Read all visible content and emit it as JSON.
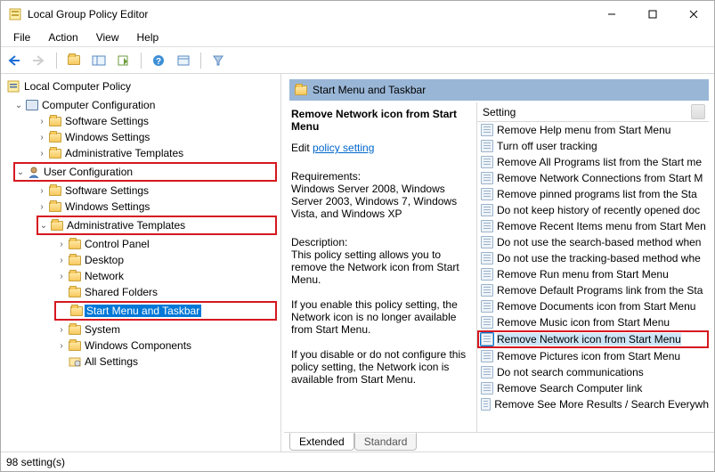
{
  "window": {
    "title": "Local Group Policy Editor"
  },
  "menus": [
    "File",
    "Action",
    "View",
    "Help"
  ],
  "tree": {
    "root": "Local Computer Policy",
    "computerConfig": "Computer Configuration",
    "cc_children": [
      "Software Settings",
      "Windows Settings",
      "Administrative Templates"
    ],
    "userConfig": "User Configuration",
    "uc_software": "Software Settings",
    "uc_windows": "Windows Settings",
    "uc_admin": "Administrative Templates",
    "at_children": [
      "Control Panel",
      "Desktop",
      "Network",
      "Shared Folders",
      "Start Menu and Taskbar",
      "System",
      "Windows Components",
      "All Settings"
    ]
  },
  "pane": {
    "header": "Start Menu and Taskbar",
    "selectedTitle": "Remove Network icon from Start Menu",
    "editPrefix": "Edit ",
    "editLink": "policy setting",
    "reqLabel": "Requirements:",
    "reqText": "Windows Server 2008, Windows Server 2003, Windows 7, Windows Vista, and Windows XP",
    "descLabel": "Description:",
    "descText": "This policy setting allows you to remove the Network icon from Start Menu.",
    "enableText": "If you enable this policy setting, the Network icon is no longer available from Start Menu.",
    "disableText": "If you disable or do not configure this policy setting, the Network icon is available from Start Menu."
  },
  "list": {
    "header": "Setting",
    "items": [
      "Remove Help menu from Start Menu",
      "Turn off user tracking",
      "Remove All Programs list from the Start me",
      "Remove Network Connections from Start M",
      "Remove pinned programs list from the Sta",
      "Do not keep history of recently opened doc",
      "Remove Recent Items menu from Start Men",
      "Do not use the search-based method when",
      "Do not use the tracking-based method whe",
      "Remove Run menu from Start Menu",
      "Remove Default Programs link from the Sta",
      "Remove Documents icon from Start Menu",
      "Remove Music icon from Start Menu",
      "Remove Network icon from Start Menu",
      "Remove Pictures icon from Start Menu",
      "Do not search communications",
      "Remove Search Computer link",
      "Remove See More Results / Search Everywh"
    ],
    "selectedIndex": 13
  },
  "tabs": {
    "extended": "Extended",
    "standard": "Standard"
  },
  "status": "98 setting(s)"
}
